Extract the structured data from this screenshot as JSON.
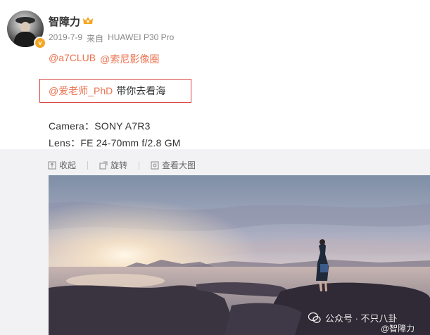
{
  "post": {
    "username": "智障力",
    "date": "2019-7-9",
    "source_prefix": "来自",
    "device": "HUAWEI P30 Pro",
    "mentions": [
      "@a7CLUB",
      "@索尼影像圈"
    ],
    "highlight_mention": "@爱老师_PhD",
    "highlight_text": "带你去看海",
    "camera": "Camera：SONY A7R3",
    "lens": "Lens：FE 24-70mm f/2.8 GM"
  },
  "actions": {
    "collapse": "收起",
    "rotate": "旋转",
    "view_large": "查看大图"
  },
  "watermark": {
    "main": "公众号 · 不只八卦",
    "sub": "@智障力"
  },
  "colors": {
    "link": "#eb7350",
    "highlight_border": "#d8403d",
    "badge": "#f5a623"
  }
}
